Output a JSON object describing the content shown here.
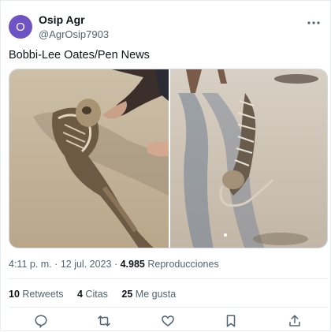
{
  "tweet": {
    "avatar_letter": "O",
    "avatar_color": "#6f53c4",
    "display_name": "Osip Agr",
    "handle": "@AgrOsip7903",
    "more_icon": "more-icon",
    "text": "Bobbi-Lee Oates/Pen News",
    "media": {
      "left_image": "mermaid-skeleton-on-beach-with-hand",
      "right_image": "skeleton-on-sand-with-shadows"
    },
    "time": "4:11 p. m.",
    "separator": "·",
    "date": "12 jul. 2023",
    "views_count": "4.985",
    "views_label": "Reproducciones",
    "stats": {
      "retweets_count": "10",
      "retweets_label": "Retweets",
      "quotes_count": "4",
      "quotes_label": "Citas",
      "likes_count": "25",
      "likes_label": "Me gusta"
    },
    "actions": [
      "reply-icon",
      "retweet-icon",
      "like-icon",
      "bookmark-icon",
      "share-icon"
    ],
    "icon_color": "#536471"
  }
}
